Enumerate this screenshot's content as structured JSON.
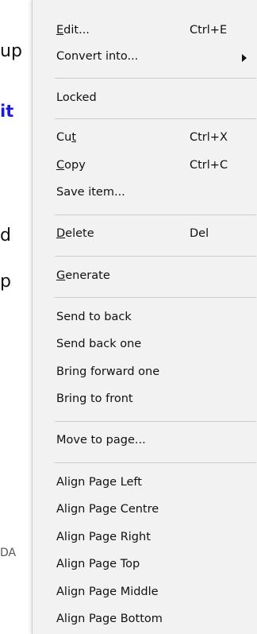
{
  "background": {
    "fragments": [
      "up",
      "it",
      "d",
      "p",
      "DA"
    ]
  },
  "menu": {
    "edit": {
      "pre": "",
      "u": "E",
      "post": "dit...",
      "shortcut": "Ctrl+E"
    },
    "convert": {
      "label": "Convert into...",
      "submenu_icon": "submenu-arrow-icon"
    },
    "locked": {
      "label": "Locked"
    },
    "cut": {
      "pre": "Cu",
      "u": "t",
      "post": "",
      "shortcut": "Ctrl+X"
    },
    "copy": {
      "pre": "",
      "u": "C",
      "post": "opy",
      "shortcut": "Ctrl+C"
    },
    "save_item": {
      "label": "Save item..."
    },
    "delete": {
      "pre": "",
      "u": "D",
      "post": "elete",
      "shortcut": "Del"
    },
    "generate": {
      "pre": "",
      "u": "G",
      "post": "enerate"
    },
    "send_to_back": {
      "label": "Send to back"
    },
    "send_back_one": {
      "label": "Send back one"
    },
    "bring_forward_one": {
      "label": "Bring forward one"
    },
    "bring_to_front": {
      "label": "Bring to front"
    },
    "move_to_page": {
      "label": "Move to page..."
    },
    "align_left": {
      "label": "Align Page Left"
    },
    "align_centre": {
      "label": "Align Page Centre"
    },
    "align_right": {
      "label": "Align Page Right"
    },
    "align_top": {
      "label": "Align Page Top"
    },
    "align_middle": {
      "label": "Align Page Middle"
    },
    "align_bottom": {
      "label": "Align Page Bottom"
    }
  }
}
